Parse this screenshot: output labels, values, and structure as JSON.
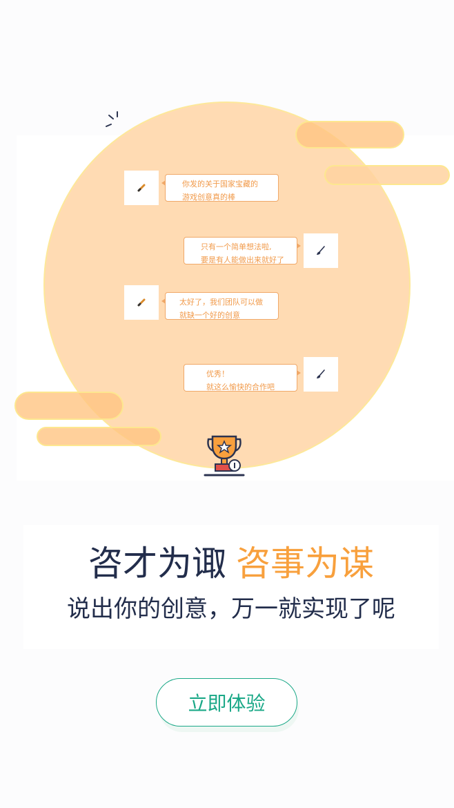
{
  "chat": {
    "messages": [
      {
        "side": "left",
        "lines": [
          "你发的关于国家宝藏的",
          "游戏创意真的棒"
        ],
        "avatar": "pencil-icon"
      },
      {
        "side": "right",
        "lines": [
          "只有一个简单想法啦,",
          "要是有人能做出来就好了"
        ],
        "avatar": "brush-icon"
      },
      {
        "side": "left",
        "lines": [
          "太好了，我们团队可以做",
          "就缺一个好的创意"
        ],
        "avatar": "pencil-icon"
      },
      {
        "side": "right",
        "lines": [
          "优秀！",
          "就这么愉快的合作吧"
        ],
        "avatar": "brush-icon"
      }
    ]
  },
  "slogan": {
    "headline_dark": "咨才为诹",
    "headline_orange": "咨事为谋",
    "subline": "说出你的创意，万一就实现了呢"
  },
  "cta": {
    "label": "立即体验"
  },
  "colors": {
    "accent_orange": "#f8a03d",
    "navy": "#222d4b",
    "green": "#1aa887",
    "circle_fill": "#ffdbb3"
  }
}
